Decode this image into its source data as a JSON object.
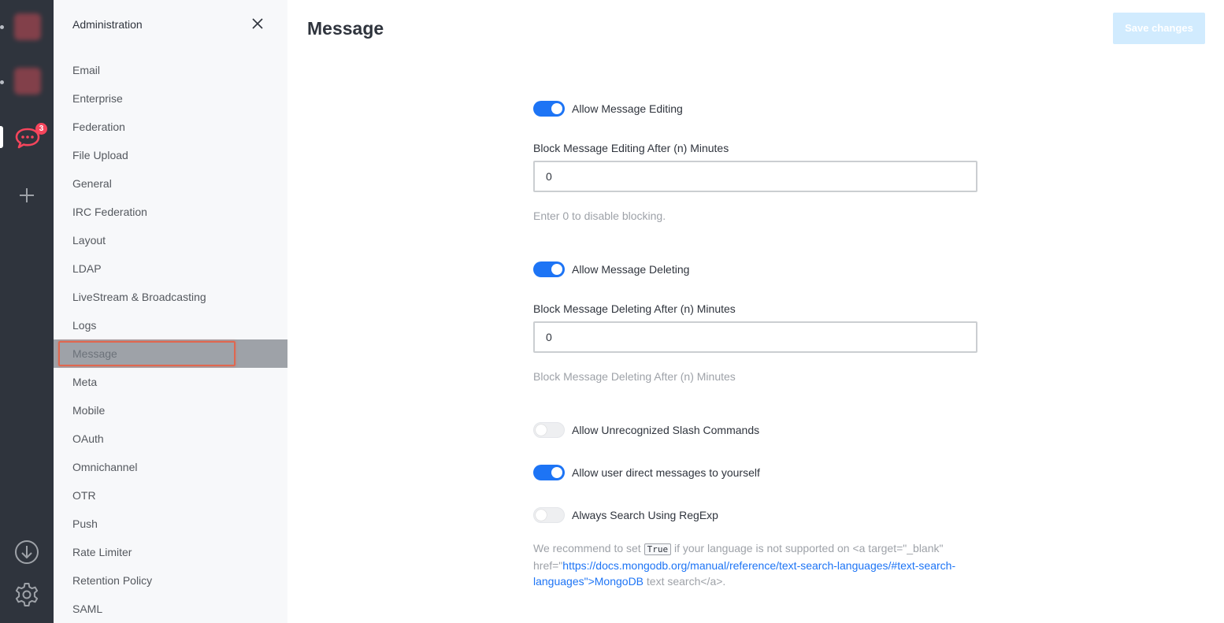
{
  "colors": {
    "accent": "#1d74f5",
    "rail": "#2f343d",
    "sidebar": "#f7f8fa",
    "active_item": "#9ea2a8",
    "highlight": "#e0674f",
    "badge": "#f5455c"
  },
  "rail": {
    "unread_badge": "3"
  },
  "sidebar": {
    "title": "Administration",
    "items": [
      {
        "label": "Email"
      },
      {
        "label": "Enterprise"
      },
      {
        "label": "Federation"
      },
      {
        "label": "File Upload"
      },
      {
        "label": "General"
      },
      {
        "label": "IRC Federation"
      },
      {
        "label": "Layout"
      },
      {
        "label": "LDAP"
      },
      {
        "label": "LiveStream & Broadcasting"
      },
      {
        "label": "Logs"
      },
      {
        "label": "Message",
        "active": true
      },
      {
        "label": "Meta"
      },
      {
        "label": "Mobile"
      },
      {
        "label": "OAuth"
      },
      {
        "label": "Omnichannel"
      },
      {
        "label": "OTR"
      },
      {
        "label": "Push"
      },
      {
        "label": "Rate Limiter"
      },
      {
        "label": "Retention Policy"
      },
      {
        "label": "SAML"
      }
    ]
  },
  "main": {
    "title": "Message",
    "save_label": "Save changes",
    "settings": {
      "allow_editing": {
        "label": "Allow Message Editing",
        "enabled": true
      },
      "block_editing": {
        "label": "Block Message Editing After (n) Minutes",
        "value": "0",
        "hint": "Enter 0 to disable blocking."
      },
      "allow_deleting": {
        "label": "Allow Message Deleting",
        "enabled": true
      },
      "block_deleting": {
        "label": "Block Message Deleting After (n) Minutes",
        "value": "0",
        "hint": "Block Message Deleting After (n) Minutes"
      },
      "allow_slash": {
        "label": "Allow Unrecognized Slash Commands",
        "enabled": false
      },
      "allow_self_dm": {
        "label": "Allow user direct messages to yourself",
        "enabled": true
      },
      "regexp": {
        "label": "Always Search Using RegExp",
        "enabled": false,
        "desc_pre": "We recommend to set",
        "desc_code": "True",
        "desc_mid": "if your language is not supported on <a target=\"_blank\" href=\"",
        "desc_link": "https://docs.mongodb.org/manual/reference/text-search-languages/#text-search-languages\">MongoDB",
        "desc_post": "text search</a>."
      }
    }
  }
}
